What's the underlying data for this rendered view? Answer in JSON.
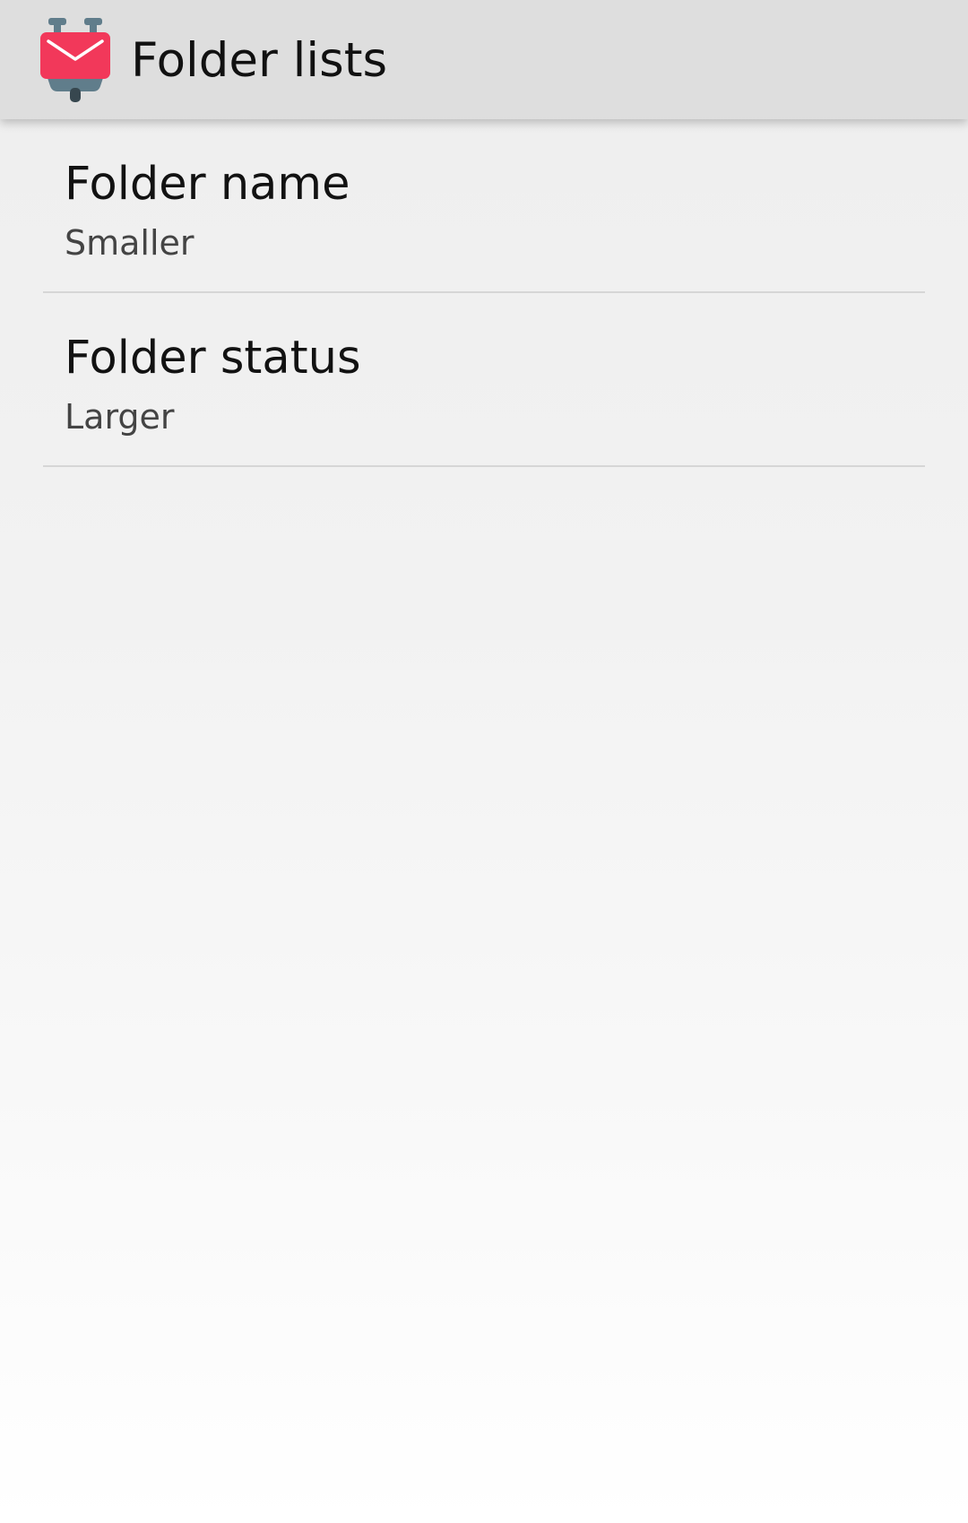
{
  "app_bar": {
    "title": "Folder lists",
    "icon": "k9-mail-app-icon"
  },
  "preferences": [
    {
      "title": "Folder name",
      "summary": "Smaller"
    },
    {
      "title": "Folder status",
      "summary": "Larger"
    }
  ],
  "colors": {
    "app_bar_bg": "#dedede",
    "icon_envelope": "#f2385a",
    "icon_body": "#607d8b"
  }
}
